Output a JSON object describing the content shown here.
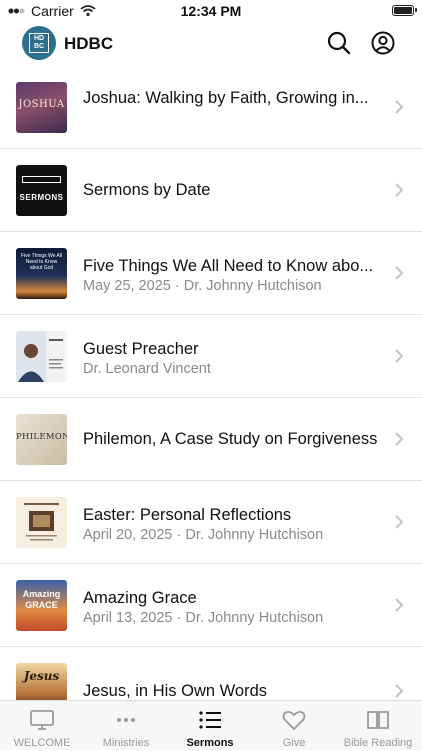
{
  "status_bar": {
    "carrier": "Carrier",
    "time": "12:34 PM"
  },
  "header": {
    "logo_text": "HD BC",
    "title": "HDBC",
    "search_icon": "search-icon",
    "account_icon": "account-icon"
  },
  "sermons": [
    {
      "title": "Joshua: Walking by Faith, Growing in...",
      "subtitle": "",
      "thumb_text": "JOSHUA"
    },
    {
      "title": "Sermons by Date",
      "subtitle": "",
      "thumb_text": "SERMONS"
    },
    {
      "title": "Five Things We All Need to Know abo...",
      "subtitle": "May 25, 2025 · Dr. Johnny Hutchison",
      "thumb_text": "Five Things We All Need to Know about God"
    },
    {
      "title": "Guest Preacher",
      "subtitle": "Dr. Leonard Vincent",
      "thumb_text": ""
    },
    {
      "title": "Philemon, A Case Study on Forgiveness",
      "subtitle": "",
      "thumb_text": "PHILEMON"
    },
    {
      "title": "Easter: Personal Reflections",
      "subtitle": "April 20, 2025 · Dr. Johnny Hutchison",
      "thumb_text": ""
    },
    {
      "title": "Amazing Grace",
      "subtitle": "April 13, 2025 · Dr. Johnny Hutchison",
      "thumb_text": "Amazing GRACE"
    },
    {
      "title": "Jesus, in His Own Words",
      "subtitle": "",
      "thumb_text": "Jesus"
    }
  ],
  "tabs": [
    {
      "label": "WELCOME",
      "icon": "tv-icon"
    },
    {
      "label": "Ministries",
      "icon": "more-dots-icon"
    },
    {
      "label": "Sermons",
      "icon": "list-icon",
      "active": true
    },
    {
      "label": "Give",
      "icon": "heart-icon"
    },
    {
      "label": "Bible Reading",
      "icon": "book-icon"
    }
  ],
  "colors": {
    "brand": "#2b6f8f",
    "divider": "#e4e4e4",
    "tab_inactive": "#9a9a9a"
  }
}
